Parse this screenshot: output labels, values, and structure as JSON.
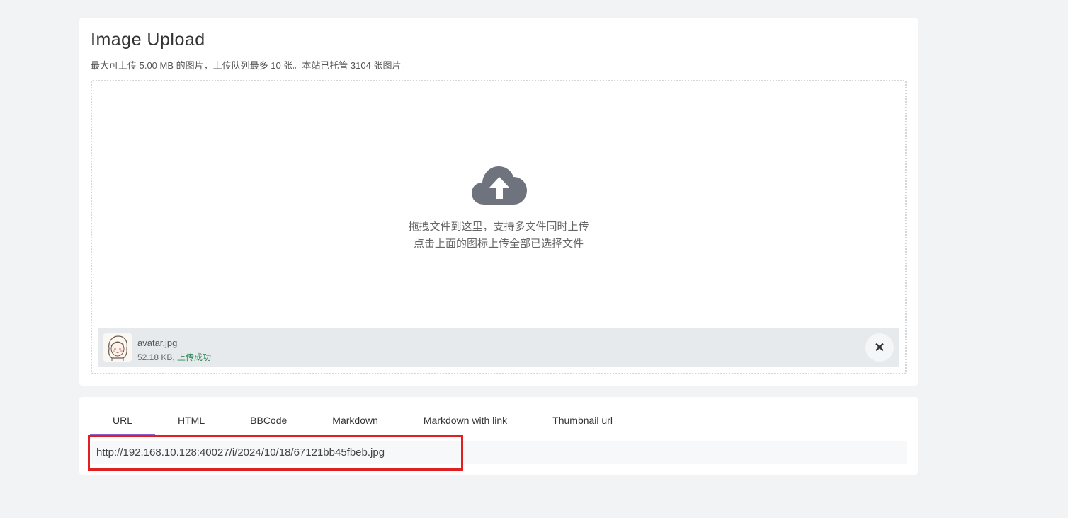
{
  "upload": {
    "title": "Image Upload",
    "subtitle": "最大可上传 5.00 MB 的图片，上传队列最多 10 张。本站已托管 3104 张图片。",
    "icon": "cloud-upload-icon",
    "hint_line1": "拖拽文件到这里，支持多文件同时上传",
    "hint_line2": "点击上面的图标上传全部已选择文件",
    "file": {
      "name": "avatar.jpg",
      "size": "52.18 KB, ",
      "status": "上传成功",
      "remove_label": "✕"
    }
  },
  "links": {
    "tabs": [
      {
        "label": "URL",
        "active": true
      },
      {
        "label": "HTML",
        "active": false
      },
      {
        "label": "BBCode",
        "active": false
      },
      {
        "label": "Markdown",
        "active": false
      },
      {
        "label": "Markdown with link",
        "active": false
      },
      {
        "label": "Thumbnail url",
        "active": false
      }
    ],
    "url_value": "http://192.168.10.128:40027/i/2024/10/18/67121bb45fbeb.jpg"
  },
  "colors": {
    "tab_active_underline": "#8a63d2",
    "highlight_box": "#e02020",
    "status_success": "#2e8b57"
  }
}
